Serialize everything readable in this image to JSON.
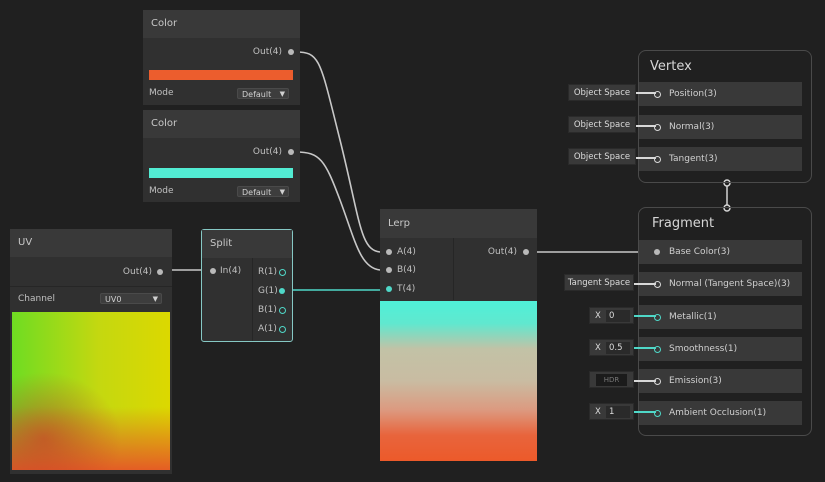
{
  "color_node_1": {
    "title": "Color",
    "out_label": "Out(4)",
    "swatch": "#ec5d2d",
    "mode_label": "Mode",
    "mode_value": "Default"
  },
  "color_node_2": {
    "title": "Color",
    "out_label": "Out(4)",
    "swatch": "#52ecd3",
    "mode_label": "Mode",
    "mode_value": "Default"
  },
  "uv_node": {
    "title": "UV",
    "out_label": "Out(4)",
    "channel_label": "Channel",
    "channel_value": "UV0"
  },
  "split_node": {
    "title": "Split",
    "in_label": "In(4)",
    "outputs": [
      "R(1)",
      "G(1)",
      "B(1)",
      "A(1)"
    ]
  },
  "lerp_node": {
    "title": "Lerp",
    "inputs": [
      "A(4)",
      "B(4)",
      "T(4)"
    ],
    "out_label": "Out(4)"
  },
  "vertex": {
    "title": "Vertex",
    "slots": [
      "Position(3)",
      "Normal(3)",
      "Tangent(3)"
    ],
    "spaces": [
      "Object Space",
      "Object Space",
      "Object Space"
    ]
  },
  "fragment": {
    "title": "Fragment",
    "slots": [
      "Base Color(3)",
      "Normal (Tangent Space)(3)",
      "Metallic(1)",
      "Smoothness(1)",
      "Emission(3)",
      "Ambient Occlusion(1)"
    ],
    "normal_space": "Tangent Space",
    "metallic": {
      "x": "X",
      "value": "0"
    },
    "smoothness": {
      "x": "X",
      "value": "0.5"
    },
    "emission_label": "HDR",
    "ao": {
      "x": "X",
      "value": "1"
    }
  }
}
